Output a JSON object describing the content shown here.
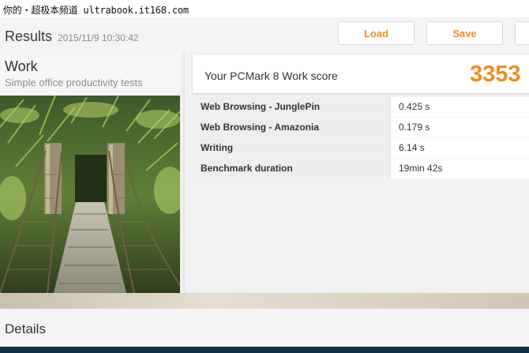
{
  "watermark": {
    "text": "你的・超极本频道 ultrabook.it168.com"
  },
  "header": {
    "title": "Results",
    "date": "2015/11/9 10:30:42",
    "load_label": "Load",
    "save_label": "Save"
  },
  "work": {
    "title": "Work",
    "subtitle": "Simple office productivity tests",
    "image_subject": "rope bridge through jungle"
  },
  "score": {
    "label": "Your PCMark 8 Work score",
    "value": "3353"
  },
  "results": [
    {
      "name": "Web Browsing - JunglePin",
      "value": "0.425 s"
    },
    {
      "name": "Web Browsing - Amazonia",
      "value": "0.179 s"
    },
    {
      "name": "Writing",
      "value": "6.14 s"
    },
    {
      "name": "Benchmark duration",
      "value": "19min 42s"
    }
  ],
  "details": {
    "title": "Details"
  },
  "colors": {
    "accent": "#f28b1f",
    "text": "#333333",
    "panel": "#f1f1f1"
  }
}
